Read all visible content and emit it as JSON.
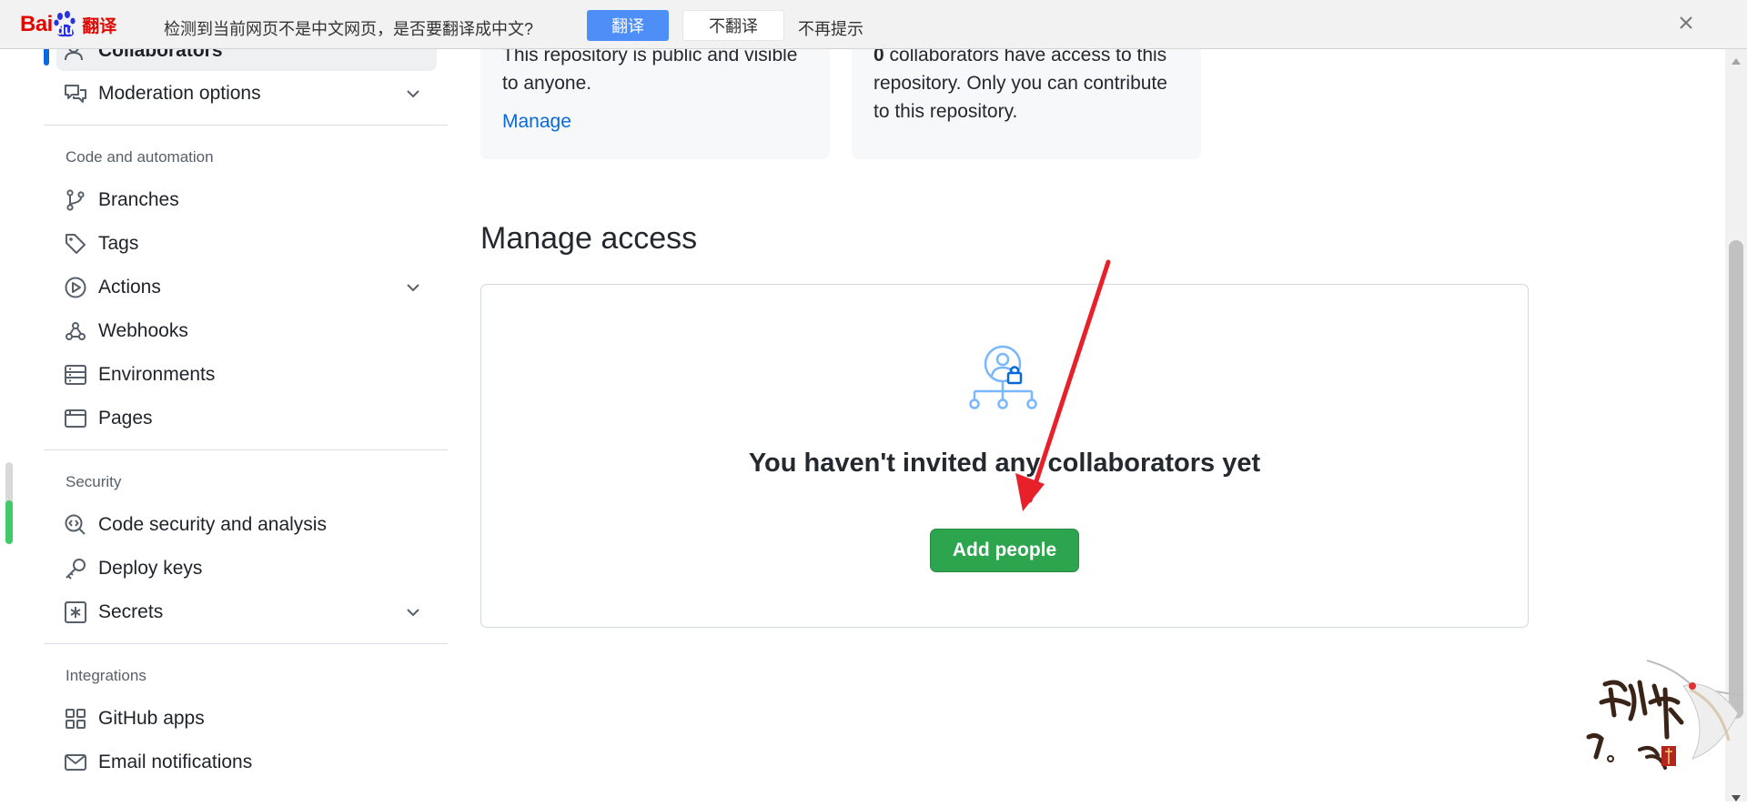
{
  "translate_bar": {
    "logo_bai": "Bai",
    "logo_du": "du",
    "logo_fanyi": "翻译",
    "question": "检测到当前网页不是中文网页，是否要翻译成中文?",
    "translate_label": "翻译",
    "dont_translate_label": "不翻译",
    "never_prompt_label": "不再提示"
  },
  "sidebar": {
    "active_item": "Collaborators",
    "moderation": "Moderation options",
    "sections": {
      "code_automation": "Code and automation",
      "security": "Security",
      "integrations": "Integrations"
    },
    "code_items": [
      "Branches",
      "Tags",
      "Actions",
      "Webhooks",
      "Environments",
      "Pages"
    ],
    "security_items": [
      "Code security and analysis",
      "Deploy keys",
      "Secrets"
    ],
    "integration_items": [
      "GitHub apps",
      "Email notifications"
    ]
  },
  "cards": {
    "visibility_line1": "This repository is public and visible",
    "visibility_line2": "to anyone.",
    "manage_link": "Manage",
    "collab_count": "0",
    "collab_line1": " collaborators have access to this",
    "collab_line2": "repository. Only you can contribute",
    "collab_line3": "to this repository."
  },
  "manage_access": {
    "title": "Manage access",
    "empty_message": "You haven't invited any collaborators yet",
    "add_button": "Add people"
  },
  "colors": {
    "accent_blue": "#0969da",
    "add_button_green": "#2da44e",
    "annotation_arrow": "#e8202a",
    "translate_button": "#4e8ef7"
  }
}
